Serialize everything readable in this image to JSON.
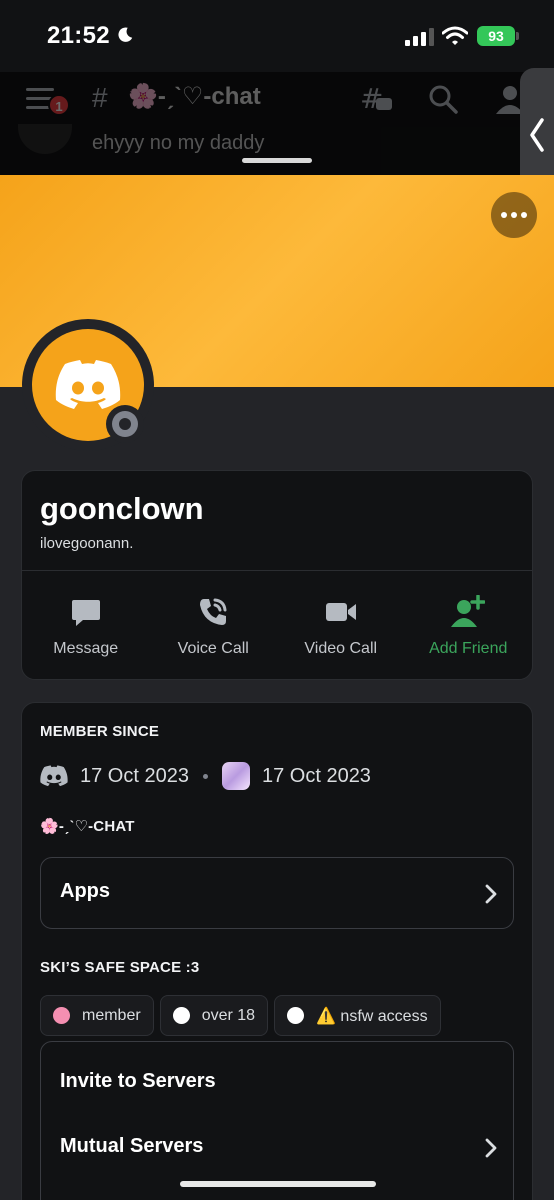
{
  "status_bar": {
    "time": "21:52",
    "battery": "93"
  },
  "background_chat": {
    "unread_badge": "1",
    "channel_hash": "#",
    "channel_name": "🌸-ˏˋ♡-chat",
    "last_message": "ehyyy no my daddy"
  },
  "profile": {
    "display_name": "goonclown",
    "username": "ilovegoonann.",
    "banner_color": "#f5a31a",
    "status": "offline",
    "actions": [
      {
        "label": "Message",
        "icon": "message-icon"
      },
      {
        "label": "Voice Call",
        "icon": "voice-call-icon"
      },
      {
        "label": "Video Call",
        "icon": "video-call-icon"
      },
      {
        "label": "Add Friend",
        "icon": "add-friend-icon",
        "color": "#3ba55c"
      }
    ]
  },
  "member_since": {
    "title": "MEMBER SINCE",
    "discord_date": "17 Oct 2023",
    "server_date": "17 Oct 2023"
  },
  "channel_section": {
    "title": "🌸-ˏˋ♡-CHAT",
    "apps_label": "Apps"
  },
  "server_section": {
    "title": "SKI’S SAFE SPACE :3",
    "roles": [
      {
        "label": "member",
        "color": "#f48fb1"
      },
      {
        "label": "over 18",
        "color": "#ffffff"
      },
      {
        "label": "⚠️ nsfw access",
        "color": "#ffffff"
      }
    ]
  },
  "servers": {
    "invite_label": "Invite to Servers",
    "mutual_label": "Mutual Servers"
  }
}
